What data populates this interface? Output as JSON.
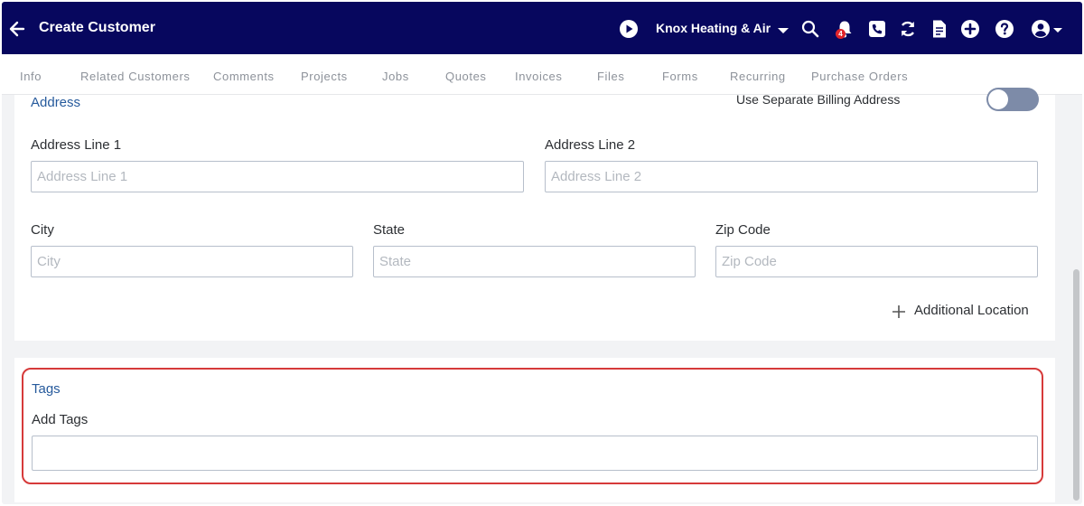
{
  "header": {
    "title": "Create Customer",
    "company": "Knox Heating & Air",
    "notification_count": "4"
  },
  "tabs": [
    "Info",
    "Related Customers",
    "Comments",
    "Projects",
    "Jobs",
    "Quotes",
    "Invoices",
    "Files",
    "Forms",
    "Recurring",
    "Purchase Orders"
  ],
  "address": {
    "section_title": "Address",
    "billing_toggle_label": "Use Separate Billing Address",
    "line1": {
      "label": "Address Line 1",
      "placeholder": "Address Line 1",
      "value": ""
    },
    "line2": {
      "label": "Address Line 2",
      "placeholder": "Address Line 2",
      "value": ""
    },
    "city": {
      "label": "City",
      "placeholder": "City",
      "value": ""
    },
    "state": {
      "label": "State",
      "placeholder": "State",
      "value": ""
    },
    "zip": {
      "label": "Zip Code",
      "placeholder": "Zip Code",
      "value": ""
    },
    "additional_location": "Additional Location"
  },
  "tags": {
    "section_title": "Tags",
    "label": "Add Tags",
    "value": ""
  },
  "colors": {
    "header_bg": "#07075e",
    "accent_blue": "#265a9c",
    "highlight_red": "#d63a3a",
    "badge_red": "#e0242b"
  }
}
